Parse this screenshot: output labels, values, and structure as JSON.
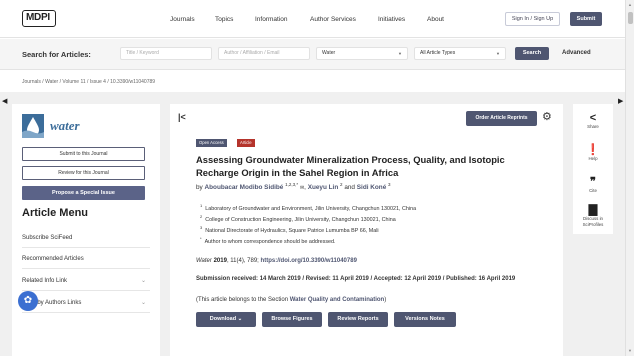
{
  "header": {
    "logo": "MDPI",
    "nav": [
      "Journals",
      "Topics",
      "Information",
      "Author Services",
      "Initiatives",
      "About"
    ],
    "signin": "Sign In / Sign Up",
    "submit": "Submit"
  },
  "search": {
    "label": "Search for Articles:",
    "title_placeholder": "Title / Keyword",
    "author_placeholder": "Author / Affiliation / Email",
    "journal_value": "Water",
    "type_value": "All Article Types",
    "search_button": "Search",
    "advanced": "Advanced"
  },
  "breadcrumb": "Journals / Water / Volume 11 / Issue 4 / 10.3390/w11040789",
  "sidebar": {
    "journal_name": "water",
    "submit_btn": "Submit to this Journal",
    "review_btn": "Review for this Journal",
    "propose_btn": "Propose a Special Issue",
    "menu_title": "Article Menu",
    "items": [
      "Subscribe SciFeed",
      "Recommended Articles",
      "Related Info Link",
      "More by Authors Links"
    ]
  },
  "article": {
    "order_reprints": "Order Article Reprints",
    "tag_open_access": "Open Access",
    "tag_article": "Article",
    "title": "Assessing Groundwater Mineralization Process, Quality, and Isotopic Recharge Origin in the Sahel Region in Africa",
    "by": "by",
    "authors": [
      {
        "name": "Aboubacar Modibo Sidibé",
        "sup": "1,2,3,*"
      },
      {
        "name": "Xueyu Lin",
        "sup": "2"
      },
      {
        "name": "Sidi Koné",
        "sup": "3"
      }
    ],
    "and_text": "and",
    "affiliations": [
      {
        "sup": "1",
        "text": "Laboratory of Groundwater and Environment, Jilin University, Changchun 130021, China"
      },
      {
        "sup": "2",
        "text": "College of Construction Engineering, Jilin University, Changchun 130021, China"
      },
      {
        "sup": "3",
        "text": "National Directorate of Hydraulics, Square Patrice Lumumba BP 66, Mali"
      },
      {
        "sup": "*",
        "text": "Author to whom correspondence should be addressed."
      }
    ],
    "citation_journal": "Water",
    "citation_year": "2019",
    "citation_rest": ", 11(4), 789;",
    "doi": "https://doi.org/10.3390/w11040789",
    "dates": "Submission received: 14 March 2019 / Revised: 11 April 2019 / Accepted: 12 April 2019 / Published: 16 April 2019",
    "section_prefix": "(This article belongs to the Section",
    "section_name": "Water Quality and Contamination",
    "section_suffix": ")",
    "buttons": [
      "Download ⌄",
      "Browse Figures",
      "Review Reports",
      "Versions Notes"
    ]
  },
  "rightbar": {
    "items": [
      {
        "icon": "share-icon",
        "label": "Share"
      },
      {
        "icon": "help-icon",
        "label": "Help"
      },
      {
        "icon": "cite-icon",
        "label": "Cite"
      },
      {
        "icon": "discuss-icon",
        "label": "Discuss in SciProfiles"
      }
    ]
  }
}
